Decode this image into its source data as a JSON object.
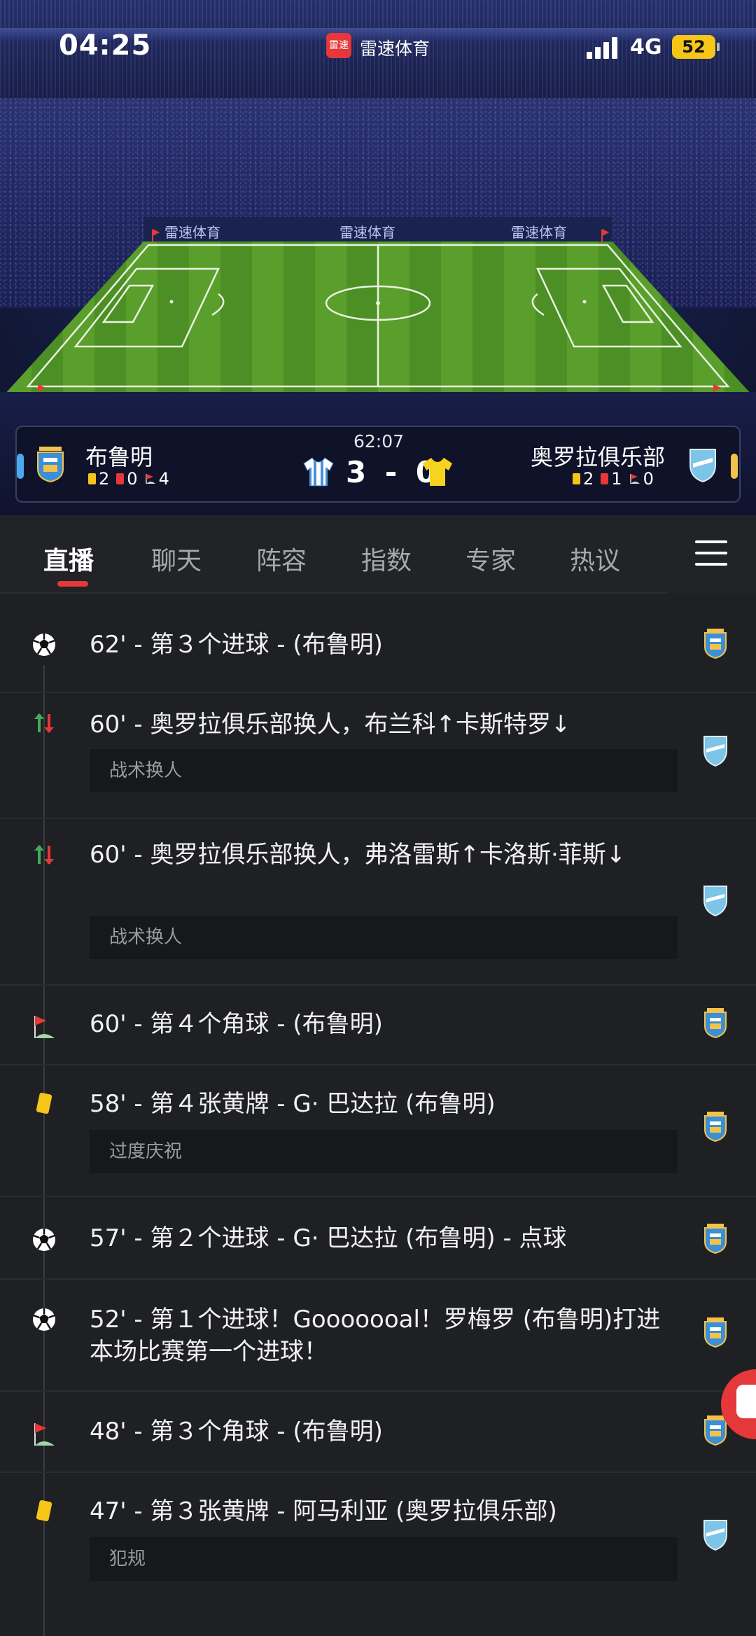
{
  "status_bar": {
    "time": "04:25",
    "app_logo_text": "雷速",
    "app_name": "雷速体育",
    "network": "4G",
    "battery": "52"
  },
  "stadium": {
    "board_texts": [
      "雷速体育",
      "雷速体育",
      "雷速体育"
    ]
  },
  "match": {
    "time": "62:07",
    "score": "3 - 0",
    "home": {
      "name": "布鲁明",
      "yellow": "2",
      "red": "0",
      "corners": "4"
    },
    "away": {
      "name": "奥罗拉俱乐部",
      "yellow": "2",
      "red": "1",
      "corners": "0"
    }
  },
  "tabs": [
    {
      "label": "直播"
    },
    {
      "label": "聊天"
    },
    {
      "label": "阵容"
    },
    {
      "label": "指数"
    },
    {
      "label": "专家"
    },
    {
      "label": "热议"
    }
  ],
  "events": [
    {
      "icon": "soccer-ball-icon",
      "team": "home",
      "title": "62' - 第３个进球 - (布鲁明)"
    },
    {
      "icon": "substitution-icon",
      "team": "away",
      "title": "60' - 奥罗拉俱乐部换人，布兰科↑卡斯特罗↓",
      "note": "战术换人"
    },
    {
      "icon": "substitution-icon",
      "team": "away",
      "title": "60' - 奥罗拉俱乐部换人，弗洛雷斯↑卡洛斯·菲斯↓",
      "note": "战术换人"
    },
    {
      "icon": "corner-flag-icon",
      "team": "home",
      "title": "60' - 第４个角球 - (布鲁明)"
    },
    {
      "icon": "yellow-card-icon",
      "team": "home",
      "title": "58' - 第４张黄牌 - G· 巴达拉 (布鲁明)",
      "note": "过度庆祝"
    },
    {
      "icon": "soccer-ball-icon",
      "team": "home",
      "title": "57' - 第２个进球 - G· 巴达拉 (布鲁明) - 点球"
    },
    {
      "icon": "soccer-ball-icon",
      "team": "home",
      "title": "52' - 第１个进球！Gooooooal！罗梅罗 (布鲁明)打进本场比赛第一个进球！"
    },
    {
      "icon": "corner-flag-icon",
      "team": "home",
      "title": "48' - 第３个角球 - (布鲁明)"
    },
    {
      "icon": "yellow-card-icon",
      "team": "away",
      "title": "47' - 第３张黄牌 - 阿马利亚 (奥罗拉俱乐部)",
      "note": "犯规"
    }
  ],
  "colors": {
    "accent": "#e5383b",
    "background": "#1f2023",
    "note_bg": "#17181a",
    "home_tag": "#4aa8f0",
    "away_tag": "#f2c24a",
    "yellow_card": "#f5c518"
  }
}
